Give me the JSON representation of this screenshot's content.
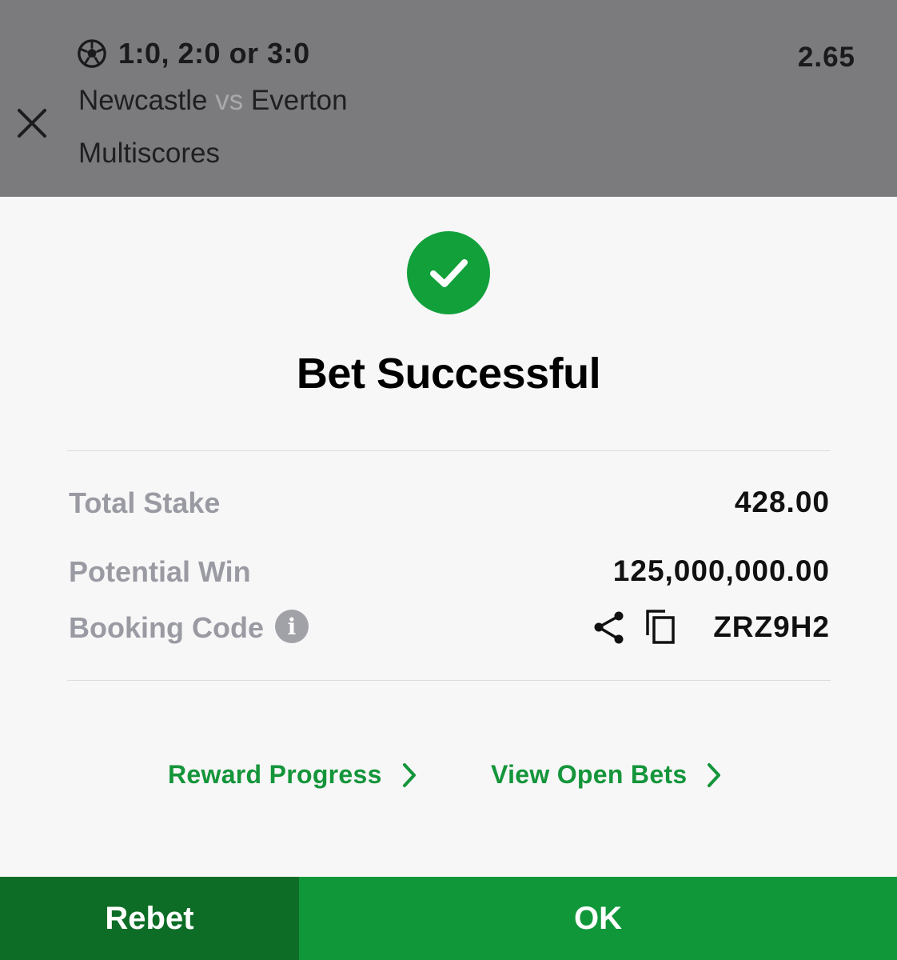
{
  "bet": {
    "selection": "1:0, 2:0 or 3:0",
    "odds": "2.65",
    "home_team": "Newcastle",
    "vs": "vs",
    "away_team": "Everton",
    "market": "Multiscores"
  },
  "result": {
    "title": "Bet Successful"
  },
  "summary": {
    "total_stake_label": "Total Stake",
    "total_stake_value": "428.00",
    "potential_win_label": "Potential Win",
    "potential_win_value": "125,000,000.00",
    "booking_code_label": "Booking Code",
    "booking_code_value": "ZRZ9H2"
  },
  "links": {
    "reward_progress": "Reward Progress",
    "view_open_bets": "View Open Bets"
  },
  "actions": {
    "rebet": "Rebet",
    "ok": "OK"
  },
  "icons": {
    "close": "close-icon",
    "sport": "soccer-ball-icon",
    "success": "checkmark-icon",
    "info": "info-icon",
    "share": "share-icon",
    "copy": "copy-icon",
    "chevron": "chevron-right-icon"
  },
  "colors": {
    "header_bg": "#7b7b7d",
    "success_green": "#12a03a",
    "link_green": "#14953a",
    "rebet_bg": "#0d6d26",
    "ok_bg": "#10973a",
    "muted_label": "#9a9aa3"
  }
}
